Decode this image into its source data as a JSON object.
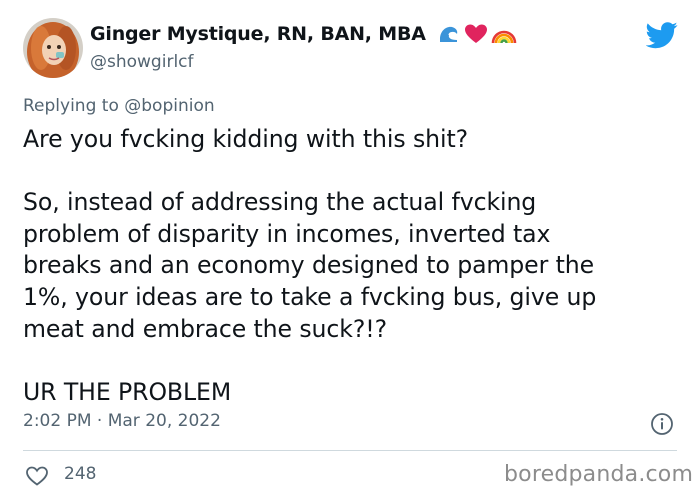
{
  "author": {
    "display_name": "Ginger Mystique, RN, BAN, MBA",
    "handle": "@showgirlcf",
    "emojis": [
      "wave-icon",
      "heart-icon",
      "rainbow-icon"
    ]
  },
  "reply": {
    "prefix": "Replying to",
    "mention": "@bopinion"
  },
  "tweet": {
    "text": "Are you fvcking kidding with this shit?\n\nSo, instead of addressing the actual fvcking\nproblem of disparity in incomes, inverted tax\nbreaks and an economy designed to pamper the\n1%, your ideas are to take a fvcking bus, give up\nmeat and embrace the suck?!?\n\nUR THE PROBLEM",
    "timestamp": "2:02 PM · Mar 20, 2022",
    "likes": "248"
  },
  "watermark": "boredpanda.com",
  "colors": {
    "twitter_blue": "#1d9bf0",
    "muted_text": "#536471",
    "heart_red": "#e0245e"
  }
}
